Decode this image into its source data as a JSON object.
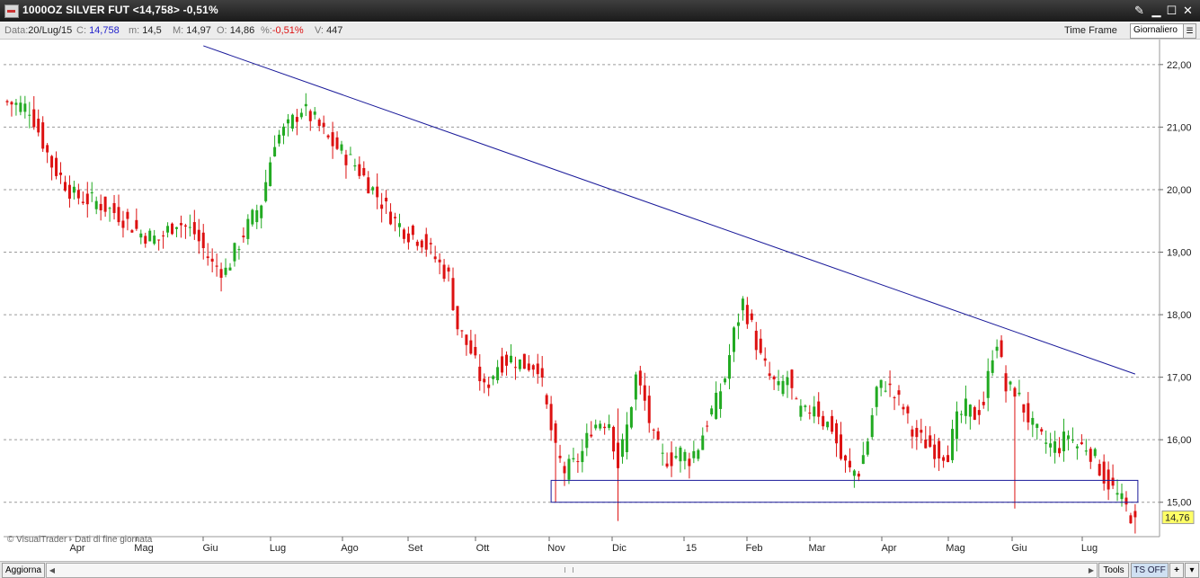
{
  "window": {
    "title": "1000OZ SILVER FUT <14,758> -0,51%",
    "buttons": [
      "tools-icon",
      "minimize-icon",
      "maximize-icon",
      "close-icon"
    ]
  },
  "infobar": {
    "data_label": "Data:",
    "data_value": "20/Lug/15",
    "close_label": "C:",
    "close_value": "14,758",
    "min_label": "m:",
    "min_value": "14,5",
    "max_label": "M:",
    "max_value": "14,97",
    "open_label": "O:",
    "open_value": "14,86",
    "pct_label": "%:",
    "pct_value": "-0,51%",
    "vol_label": "V:",
    "vol_value": "447",
    "timeframe_label": "Time Frame",
    "timeframe_value": "Giornaliero"
  },
  "watermark": "© VisualTrader - Dati di fine giornata",
  "bottombar": {
    "refresh_label": "Aggiorna",
    "tools_label": "Tools",
    "ts_label": "TS OFF",
    "plus_label": "+"
  },
  "colors": {
    "up": "#22aa22",
    "down": "#dd1111",
    "trendline": "#1a1a9a",
    "price_tag": "#ffff66",
    "grid": "#9a9a9a"
  },
  "chart_data": {
    "type": "candlestick",
    "y_axis": {
      "ticks": [
        "22,00",
        "21,00",
        "20,00",
        "19,00",
        "18,00",
        "17,00",
        "16,00",
        "15,00"
      ],
      "ylim": [
        14.45,
        22.4
      ],
      "side": "right"
    },
    "x_axis": {
      "ticks": [
        "Apr",
        "Mag",
        "Giu",
        "Lug",
        "Ago",
        "Set",
        "Ott",
        "Nov",
        "Dic",
        "15",
        "Feb",
        "Mar",
        "Apr",
        "Mag",
        "Giu",
        "Lug"
      ]
    },
    "last_price_label": "14,76",
    "last_price": 14.76,
    "price_path": [
      [
        0,
        21.4
      ],
      [
        5,
        21.3
      ],
      [
        10,
        20.4
      ],
      [
        15,
        19.9
      ],
      [
        20,
        19.8
      ],
      [
        25,
        19.6
      ],
      [
        30,
        19.3
      ],
      [
        34,
        19.2
      ],
      [
        38,
        19.5
      ],
      [
        42,
        19.3
      ],
      [
        46,
        18.8
      ],
      [
        49,
        18.7
      ],
      [
        53,
        19.3
      ],
      [
        57,
        19.8
      ],
      [
        60,
        20.8
      ],
      [
        63,
        21.0
      ],
      [
        66,
        21.3
      ],
      [
        69,
        21.1
      ],
      [
        72,
        20.8
      ],
      [
        75,
        20.6
      ],
      [
        78,
        20.4
      ],
      [
        81,
        20.1
      ],
      [
        84,
        19.8
      ],
      [
        87,
        19.5
      ],
      [
        90,
        19.3
      ],
      [
        93,
        19.2
      ],
      [
        96,
        18.9
      ],
      [
        99,
        18.6
      ],
      [
        101,
        17.8
      ],
      [
        104,
        17.4
      ],
      [
        107,
        16.8
      ],
      [
        110,
        17.2
      ],
      [
        113,
        17.3
      ],
      [
        116,
        17.2
      ],
      [
        119,
        17.2
      ],
      [
        121,
        16.5
      ],
      [
        123,
        15.8
      ],
      [
        125,
        15.5
      ],
      [
        127,
        15.6
      ],
      [
        129,
        15.8
      ],
      [
        131,
        16.2
      ],
      [
        133,
        16.3
      ],
      [
        135,
        16.3
      ],
      [
        137,
        15.6
      ],
      [
        139,
        16.2
      ],
      [
        141,
        17.0
      ],
      [
        143,
        16.6
      ],
      [
        145,
        16.0
      ],
      [
        147,
        15.7
      ],
      [
        149,
        15.7
      ],
      [
        151,
        15.8
      ],
      [
        153,
        15.7
      ],
      [
        155,
        15.9
      ],
      [
        157,
        16.3
      ],
      [
        159,
        16.6
      ],
      [
        161,
        17.0
      ],
      [
        163,
        17.7
      ],
      [
        165,
        18.2
      ],
      [
        167,
        17.8
      ],
      [
        169,
        17.3
      ],
      [
        171,
        17.0
      ],
      [
        173,
        16.8
      ],
      [
        175,
        17.0
      ],
      [
        177,
        16.5
      ],
      [
        179,
        16.4
      ],
      [
        181,
        16.6
      ],
      [
        183,
        16.3
      ],
      [
        185,
        16.2
      ],
      [
        187,
        15.7
      ],
      [
        189,
        15.5
      ],
      [
        191,
        15.5
      ],
      [
        193,
        16.0
      ],
      [
        195,
        16.8
      ],
      [
        197,
        16.9
      ],
      [
        199,
        16.7
      ],
      [
        201,
        16.5
      ],
      [
        203,
        16.1
      ],
      [
        205,
        16.0
      ],
      [
        207,
        15.9
      ],
      [
        209,
        15.8
      ],
      [
        211,
        15.8
      ],
      [
        213,
        16.3
      ],
      [
        215,
        16.5
      ],
      [
        217,
        16.4
      ],
      [
        219,
        16.6
      ],
      [
        221,
        17.4
      ],
      [
        222,
        17.6
      ],
      [
        224,
        16.8
      ],
      [
        226,
        16.8
      ],
      [
        228,
        16.5
      ],
      [
        230,
        16.2
      ],
      [
        232,
        16.0
      ],
      [
        234,
        15.9
      ],
      [
        236,
        15.9
      ],
      [
        238,
        16.1
      ],
      [
        240,
        15.9
      ],
      [
        242,
        15.9
      ],
      [
        244,
        15.7
      ],
      [
        246,
        15.4
      ],
      [
        248,
        15.2
      ],
      [
        250,
        15.0
      ],
      [
        252,
        14.8
      ],
      [
        253,
        14.76
      ]
    ],
    "shocks": [
      [
        137,
        14.7,
        16.5
      ],
      [
        123,
        15.0,
        15.5
      ],
      [
        226,
        14.9,
        15.4
      ]
    ],
    "trendline": {
      "from": [
        44,
        22.3
      ],
      "to": [
        253,
        17.05
      ]
    },
    "support_box": {
      "from_idx": 122,
      "to_idx": 253,
      "top": 15.35,
      "bottom": 15.0
    }
  }
}
